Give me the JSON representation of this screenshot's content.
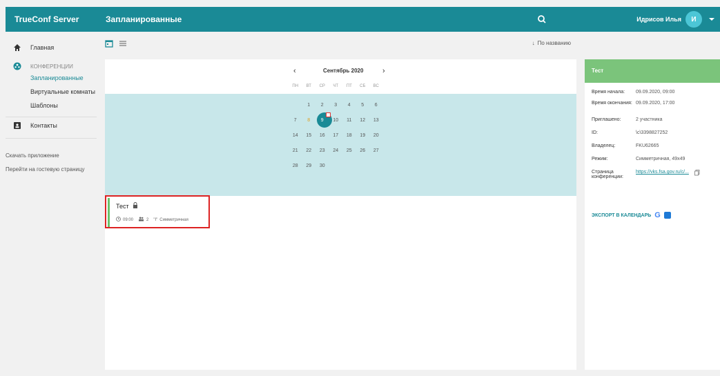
{
  "app": {
    "brand": "TrueConf Server",
    "page_title": "Запланированные"
  },
  "user": {
    "name": "Идрисов Илья",
    "avatar_letter": "И"
  },
  "sidebar": {
    "home": "Главная",
    "conferences": "КОНФЕРЕНЦИИ",
    "scheduled": "Запланированные",
    "virtual_rooms": "Виртуальные комнаты",
    "templates": "Шаблоны",
    "contacts": "Контакты",
    "download_app": "Скачать приложение",
    "guest_page": "Перейти на гостевую страницу"
  },
  "toolbar": {
    "sort_label": "По названию"
  },
  "calendar": {
    "prev": "‹",
    "next": "›",
    "month": "Сентябрь 2020",
    "weekdays": [
      "ПН",
      "ВТ",
      "СР",
      "ЧТ",
      "ПТ",
      "СБ",
      "ВС"
    ],
    "weeks": [
      [
        "",
        "1",
        "2",
        "3",
        "4",
        "5",
        "6"
      ],
      [
        "7",
        "8",
        "9",
        "10",
        "11",
        "12",
        "13"
      ],
      [
        "14",
        "15",
        "16",
        "17",
        "18",
        "19",
        "20"
      ],
      [
        "21",
        "22",
        "23",
        "24",
        "25",
        "26",
        "27"
      ],
      [
        "28",
        "29",
        "30",
        "",
        "",
        "",
        ""
      ]
    ],
    "today": "8",
    "selected": "9"
  },
  "event": {
    "title": "Тест",
    "time": "09:00",
    "participants": "2",
    "mode": "Симметричная"
  },
  "detail": {
    "title": "Тест",
    "rows": [
      {
        "k": "Время начала:",
        "v": "09.09.2020, 09:00"
      },
      {
        "k": "Время окончания:",
        "v": "09.09.2020, 17:00"
      },
      {
        "k": "Приглашено:",
        "v": "2 участника"
      },
      {
        "k": "ID:",
        "v": "\\c\\3398827252"
      },
      {
        "k": "Владелец:",
        "v": "FKU62665"
      },
      {
        "k": "Режим:",
        "v": "Симметричная, 49x49"
      },
      {
        "k": "Страница конференции:",
        "v": "https://vks.fsa.gov.ru/c/..."
      }
    ],
    "export_label": "ЭКСПОРТ В КАЛЕНДАРЬ"
  },
  "colors": {
    "accent": "#1a8a96",
    "event_green": "#7bc47b",
    "highlight": "#c8e7ea"
  }
}
